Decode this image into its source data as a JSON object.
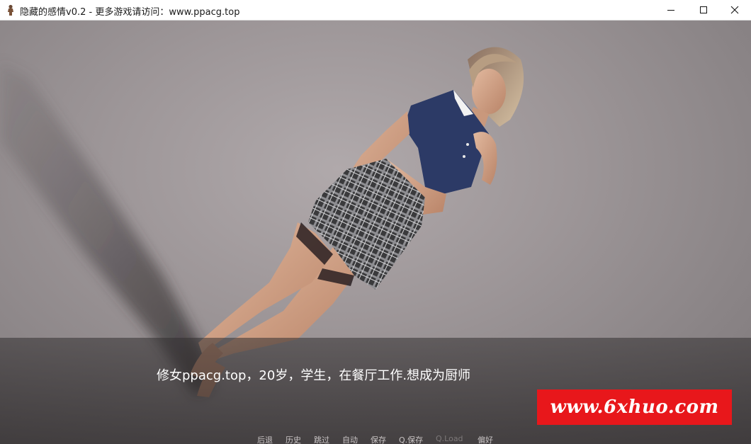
{
  "window": {
    "title": "隐藏的感情v0.2 - 更多游戏请访问：www.ppacg.top",
    "icon": "app-character-icon",
    "controls": [
      "minimize-icon",
      "maximize-icon",
      "close-icon"
    ]
  },
  "dialogue": {
    "text": "修女ppacg.top，20岁，学生，在餐厅工作.想成为厨师"
  },
  "watermark": {
    "text": "www.6xhuo.com",
    "color": "#e8171b"
  },
  "quick_menu": {
    "back": "后退",
    "history": "历史",
    "skip": "跳过",
    "auto": "自动",
    "save": "保存",
    "qsave": "Q.保存",
    "qload": "Q.Load",
    "prefs": "偏好"
  },
  "colors": {
    "background": "#8f8a8b",
    "text": "#ffffff",
    "menu_text": "#c9c4c5",
    "menu_disabled": "#7d7879"
  }
}
